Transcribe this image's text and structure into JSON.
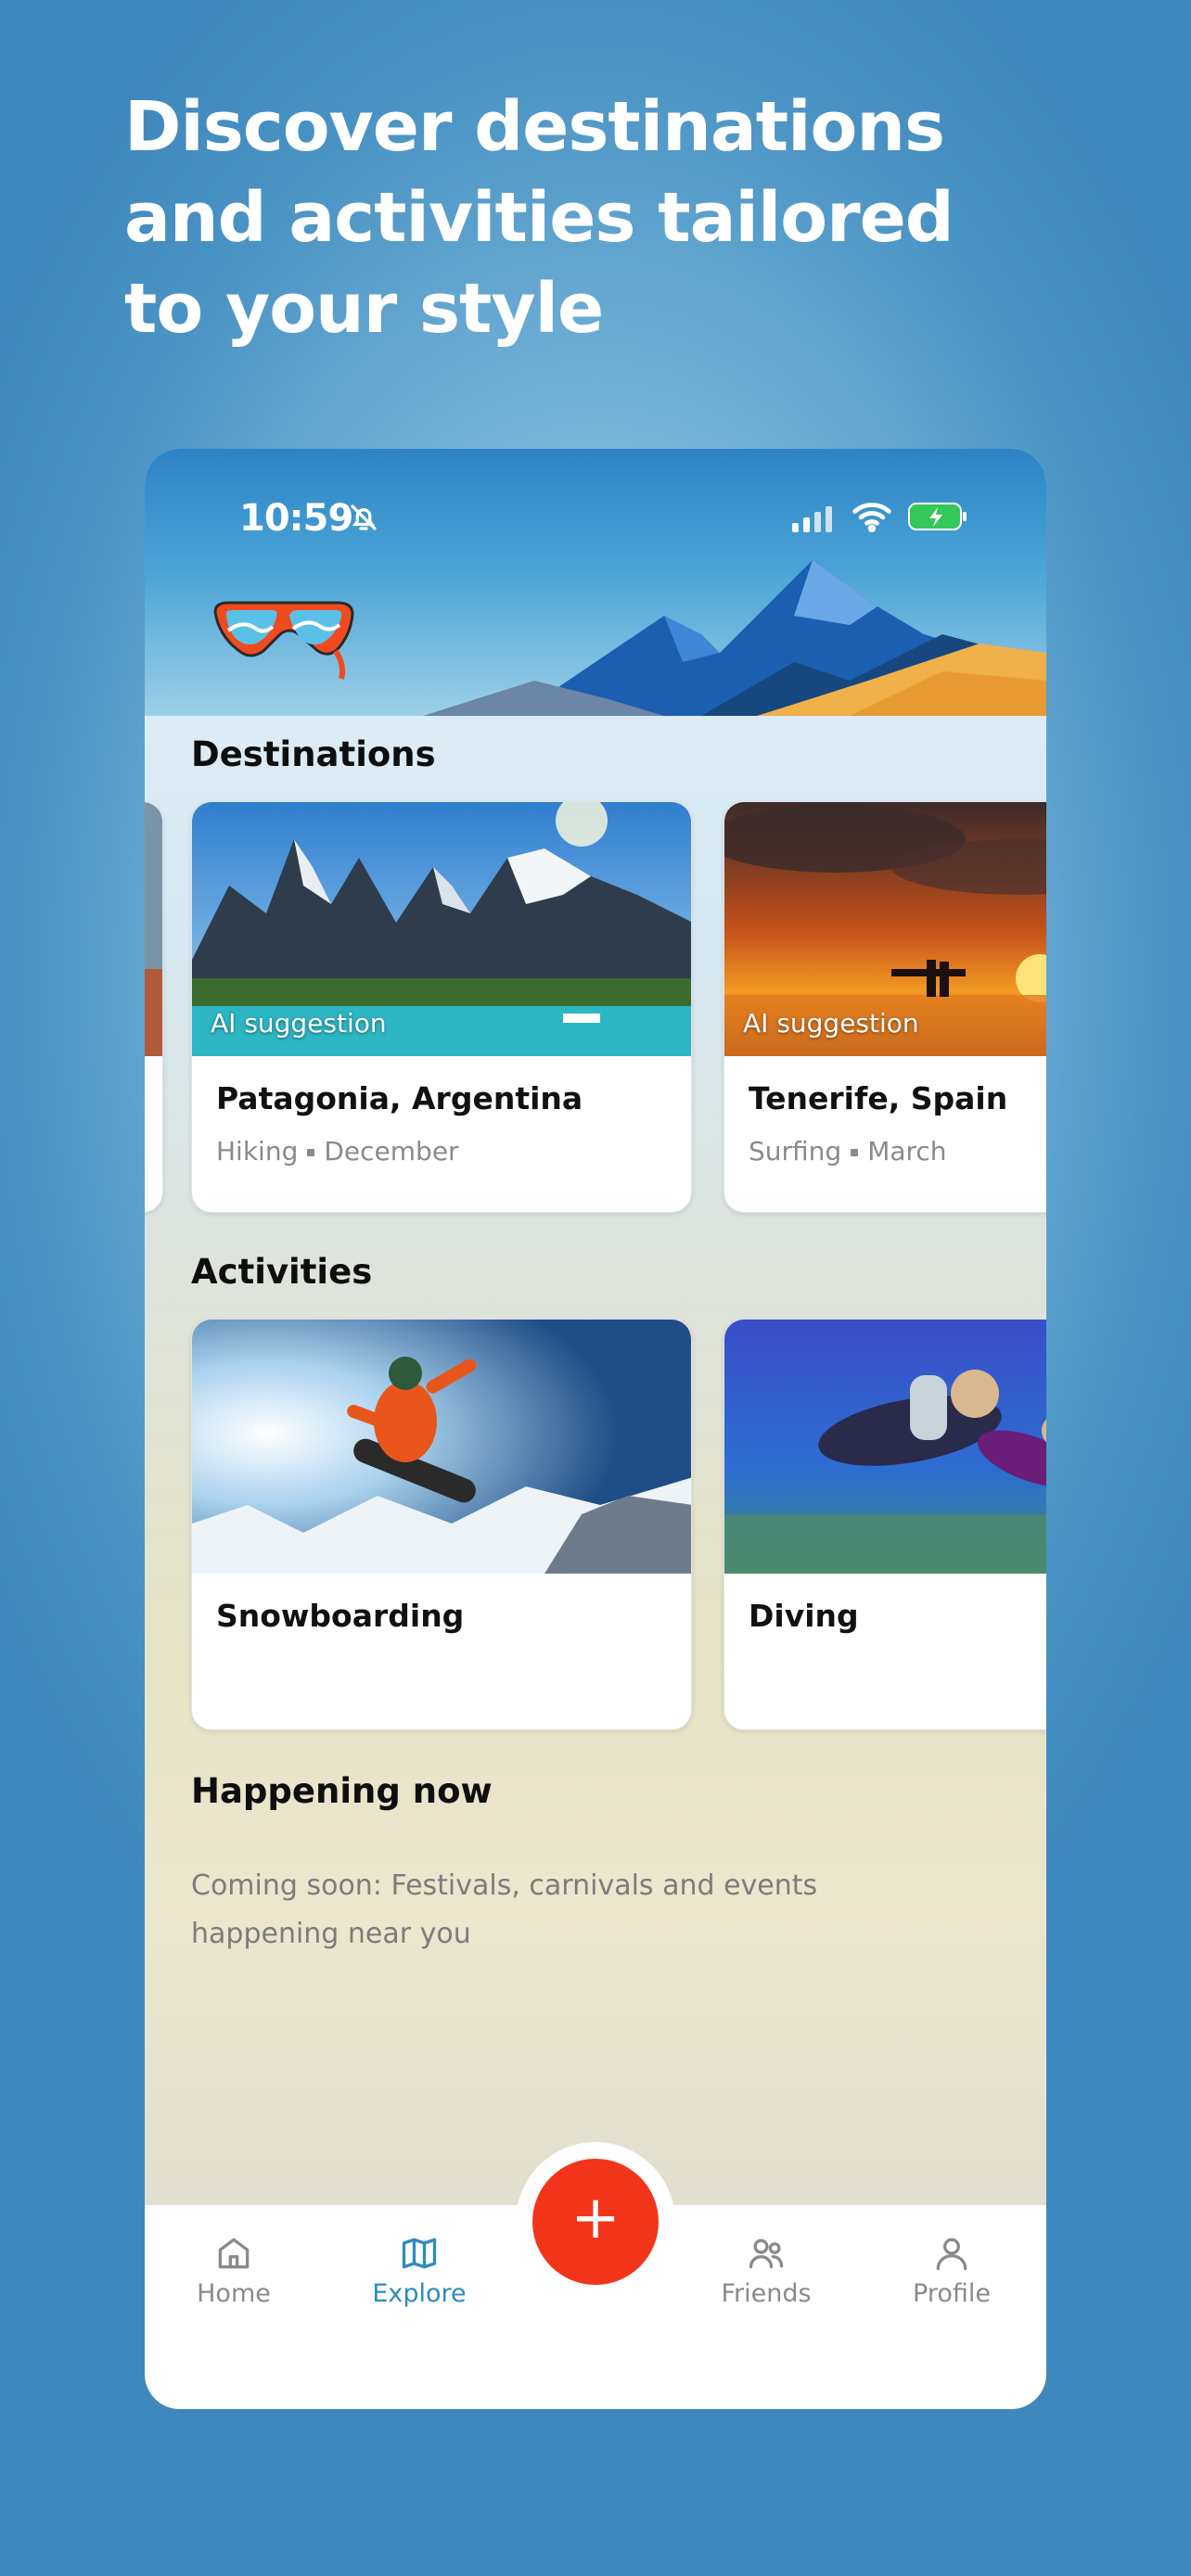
{
  "headline": "Discover destinations and activities tailored to your style",
  "status_bar": {
    "time": "10:59"
  },
  "sections": {
    "destinations": "Destinations",
    "activities": "Activities",
    "happening": "Happening now"
  },
  "destinations": [
    {
      "tag": "AI suggestion",
      "name": "Patagonia, Argentina",
      "activity": "Hiking",
      "month": "December"
    },
    {
      "tag": "AI suggestion",
      "name": "Tenerife, Spain",
      "activity": "Surfing",
      "month": "March"
    }
  ],
  "activities": [
    {
      "name": "Snowboarding"
    },
    {
      "name": "Diving"
    }
  ],
  "happening_text": "Coming soon: Festivals, carnivals and events happening near you",
  "tabs": [
    {
      "label": "Home",
      "icon": "home-icon"
    },
    {
      "label": "Explore",
      "icon": "map-icon"
    },
    {
      "label": "Friends",
      "icon": "users-icon"
    },
    {
      "label": "Profile",
      "icon": "user-icon"
    }
  ],
  "fab": {
    "icon": "plus-icon",
    "symbol": "+"
  },
  "colors": {
    "accent": "#2d8bc0",
    "fab": "#f2341a",
    "background": "#4a93c4"
  }
}
